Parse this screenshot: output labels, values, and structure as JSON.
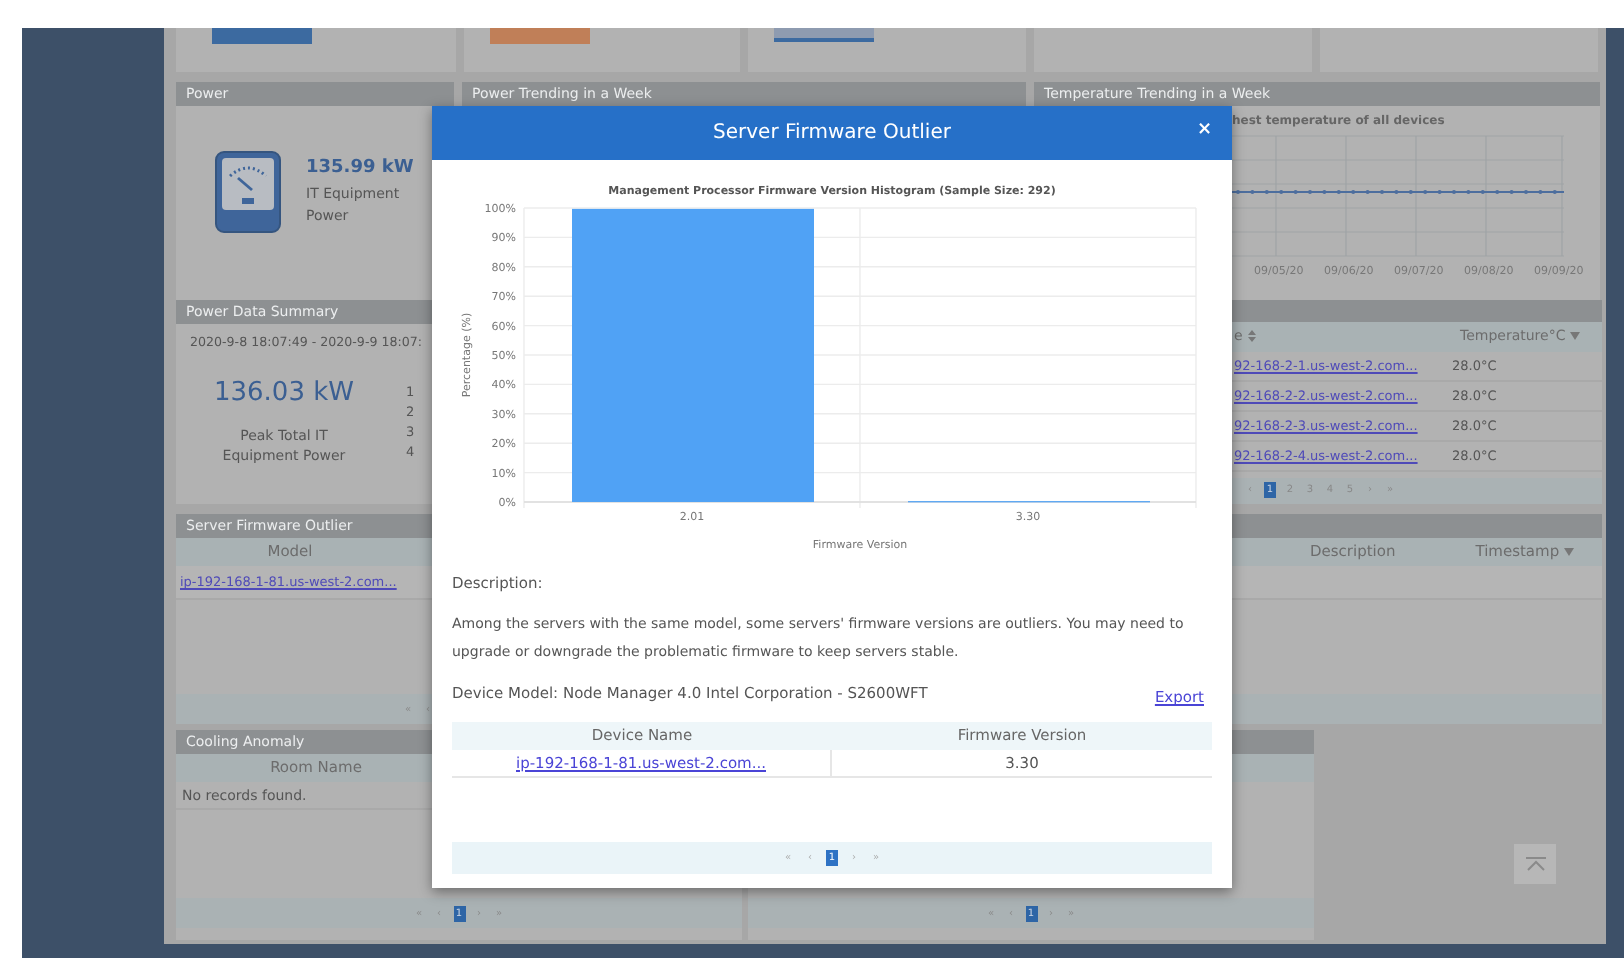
{
  "power": {
    "title": "Power",
    "value": "135.99 kW",
    "label": "IT Equipment Power"
  },
  "power_trending": {
    "title": "Power Trending in a Week"
  },
  "temperature_trending": {
    "title": "Temperature Trending in a Week",
    "subtitle": "hest temperature of all devices",
    "dates": [
      "09/05/20",
      "09/06/20",
      "09/07/20",
      "09/08/20",
      "09/09/20"
    ]
  },
  "power_data_summary": {
    "title": "Power Data Summary",
    "range": "2020-9-8 18:07:49 - 2020-9-9 18:07:",
    "value": "136.03 kW",
    "label": "Peak Total IT Equipment Power",
    "row_numbers": [
      "1",
      "2",
      "3",
      "4"
    ]
  },
  "temperature_table": {
    "columns": [
      "e",
      "Temperature°C"
    ],
    "rows": [
      {
        "device": "92-168-2-1.us-west-2.com...",
        "temperature": "28.0°C"
      },
      {
        "device": "92-168-2-2.us-west-2.com...",
        "temperature": "28.0°C"
      },
      {
        "device": "92-168-2-3.us-west-2.com...",
        "temperature": "28.0°C"
      },
      {
        "device": "92-168-2-4.us-west-2.com...",
        "temperature": "28.0°C"
      }
    ],
    "pagination": [
      {
        "label": "‹",
        "selected": false
      },
      {
        "label": "1",
        "selected": true
      },
      {
        "label": "2",
        "selected": false
      },
      {
        "label": "3",
        "selected": false
      },
      {
        "label": "4",
        "selected": false
      },
      {
        "label": "5",
        "selected": false
      },
      {
        "label": "›",
        "selected": false
      },
      {
        "label": "»",
        "selected": false
      }
    ]
  },
  "server_firmware_outlier": {
    "title": "Server Firmware Outlier",
    "columns": [
      "Model",
      "Description",
      "Timestamp"
    ],
    "rows": [
      {
        "model": "ip-192-168-1-81.us-west-2.com..."
      }
    ],
    "pagination": [
      {
        "label": "«",
        "selected": false
      },
      {
        "label": "‹",
        "selected": false
      }
    ]
  },
  "cooling_anomaly": {
    "title": "Cooling Anomaly",
    "columns": [
      "Room Name"
    ],
    "empty_text": "No records found.",
    "pagination": [
      {
        "label": "«",
        "selected": false
      },
      {
        "label": "‹",
        "selected": false
      },
      {
        "label": "1",
        "selected": true
      },
      {
        "label": "›",
        "selected": false
      },
      {
        "label": "»",
        "selected": false
      }
    ]
  },
  "second_anomaly_panel": {
    "pagination": [
      {
        "label": "«",
        "selected": false
      },
      {
        "label": "‹",
        "selected": false
      },
      {
        "label": "1",
        "selected": true
      },
      {
        "label": "›",
        "selected": false
      },
      {
        "label": "»",
        "selected": false
      }
    ]
  },
  "modal": {
    "title": "Server Firmware Outlier",
    "close": "×",
    "chart_data": {
      "type": "bar",
      "title": "Management Processor Firmware Version Histogram (Sample Size: 292)",
      "xlabel": "Firmware Version",
      "ylabel": "Percentage (%)",
      "categories": [
        "2.01",
        "3.30"
      ],
      "values": [
        99.7,
        0.3
      ],
      "ylim": [
        0,
        100
      ],
      "grid": true,
      "yticks": [
        {
          "value": 0,
          "label": "0%"
        },
        {
          "value": 10,
          "label": "10%"
        },
        {
          "value": 20,
          "label": "20%"
        },
        {
          "value": 30,
          "label": "30%"
        },
        {
          "value": 40,
          "label": "40%"
        },
        {
          "value": 50,
          "label": "50%"
        },
        {
          "value": 60,
          "label": "60%"
        },
        {
          "value": 70,
          "label": "70%"
        },
        {
          "value": 80,
          "label": "80%"
        },
        {
          "value": 90,
          "label": "90%"
        },
        {
          "value": 100,
          "label": "100%"
        }
      ]
    },
    "description_label": "Description:",
    "description": "Among the servers with the same model, some servers' firmware versions are outliers. You may need to upgrade or downgrade the problematic firmware to keep servers stable.",
    "device_model": "Device Model: Node Manager 4.0 Intel Corporation - S2600WFT",
    "export": "Export",
    "columns": [
      "Device Name",
      "Firmware Version"
    ],
    "rows": [
      {
        "device": "ip-192-168-1-81.us-west-2.com...",
        "firmware": "3.30"
      }
    ],
    "pagination": [
      {
        "label": "«",
        "selected": false
      },
      {
        "label": "‹",
        "selected": false
      },
      {
        "label": "1",
        "selected": true
      },
      {
        "label": "›",
        "selected": false
      },
      {
        "label": "»",
        "selected": false
      }
    ]
  }
}
